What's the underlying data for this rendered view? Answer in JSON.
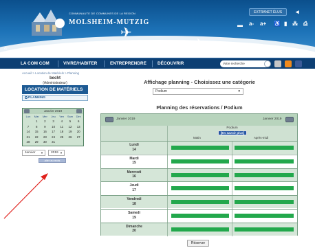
{
  "header": {
    "brand_small_line1": "COMMUNAUTE DE COMMUNES DE LA REGION",
    "brand_big": "MOLSHEIM-MUTZIG",
    "extranet_label": "EXTRANET ÉLUS",
    "font_controls": [
      "a-",
      "a+"
    ],
    "colors": {
      "banner": "#1d73b8",
      "nav": "#0d3f73"
    }
  },
  "nav": {
    "items": [
      "LA COM COM",
      "VIVRE/HABITER",
      "ENTREPRENDRE",
      "DÉCOUVRIR"
    ],
    "search_placeholder": "Votre recherche"
  },
  "sidebar": {
    "breadcrumb": "Accueil > Location de Matériels > Planning",
    "user_name": "becht",
    "user_role": "(Administrateur)",
    "section_title": "LOCATION DE MATÉRIELS",
    "menu_item": "PLANNING",
    "mini_calendar": {
      "title": "Janvier 2019",
      "dow": [
        "Lun",
        "Mar",
        "Mer",
        "Jeu",
        "Ven",
        "Sam",
        "Dim"
      ],
      "weeks": [
        [
          "",
          "1",
          "2",
          "3",
          "4",
          "5",
          "6"
        ],
        [
          "7",
          "8",
          "9",
          "10",
          "11",
          "12",
          "13"
        ],
        [
          "14",
          "15",
          "16",
          "17",
          "18",
          "19",
          "20"
        ],
        [
          "21",
          "22",
          "23",
          "24",
          "25",
          "26",
          "27"
        ],
        [
          "28",
          "29",
          "30",
          "31",
          "",
          "",
          ""
        ]
      ]
    },
    "month_select": "Janvier",
    "year_select": "2019",
    "go_button": "aller au mois"
  },
  "main": {
    "title": "Affichage planning - Choisissez une catégorie",
    "category_select": "Podium",
    "planning_title": "Planning des réservations / Podium",
    "grid": {
      "month_left": "Janvier 2019",
      "month_right": "Janvier 2019",
      "resource": "Podium",
      "more_link": "[En savoir plus]",
      "col_morning": "Matin",
      "col_afternoon": "Après-midi",
      "slot_color": "#22a84c",
      "days": [
        {
          "name": "Lundi",
          "num": "14"
        },
        {
          "name": "Mardi",
          "num": "15"
        },
        {
          "name": "Mercredi",
          "num": "16"
        },
        {
          "name": "Jeudi",
          "num": "17"
        },
        {
          "name": "Vendredi",
          "num": "18"
        },
        {
          "name": "Samedi",
          "num": "19"
        },
        {
          "name": "Dimanche",
          "num": "20"
        }
      ]
    },
    "reserve_button": "Réserver"
  }
}
